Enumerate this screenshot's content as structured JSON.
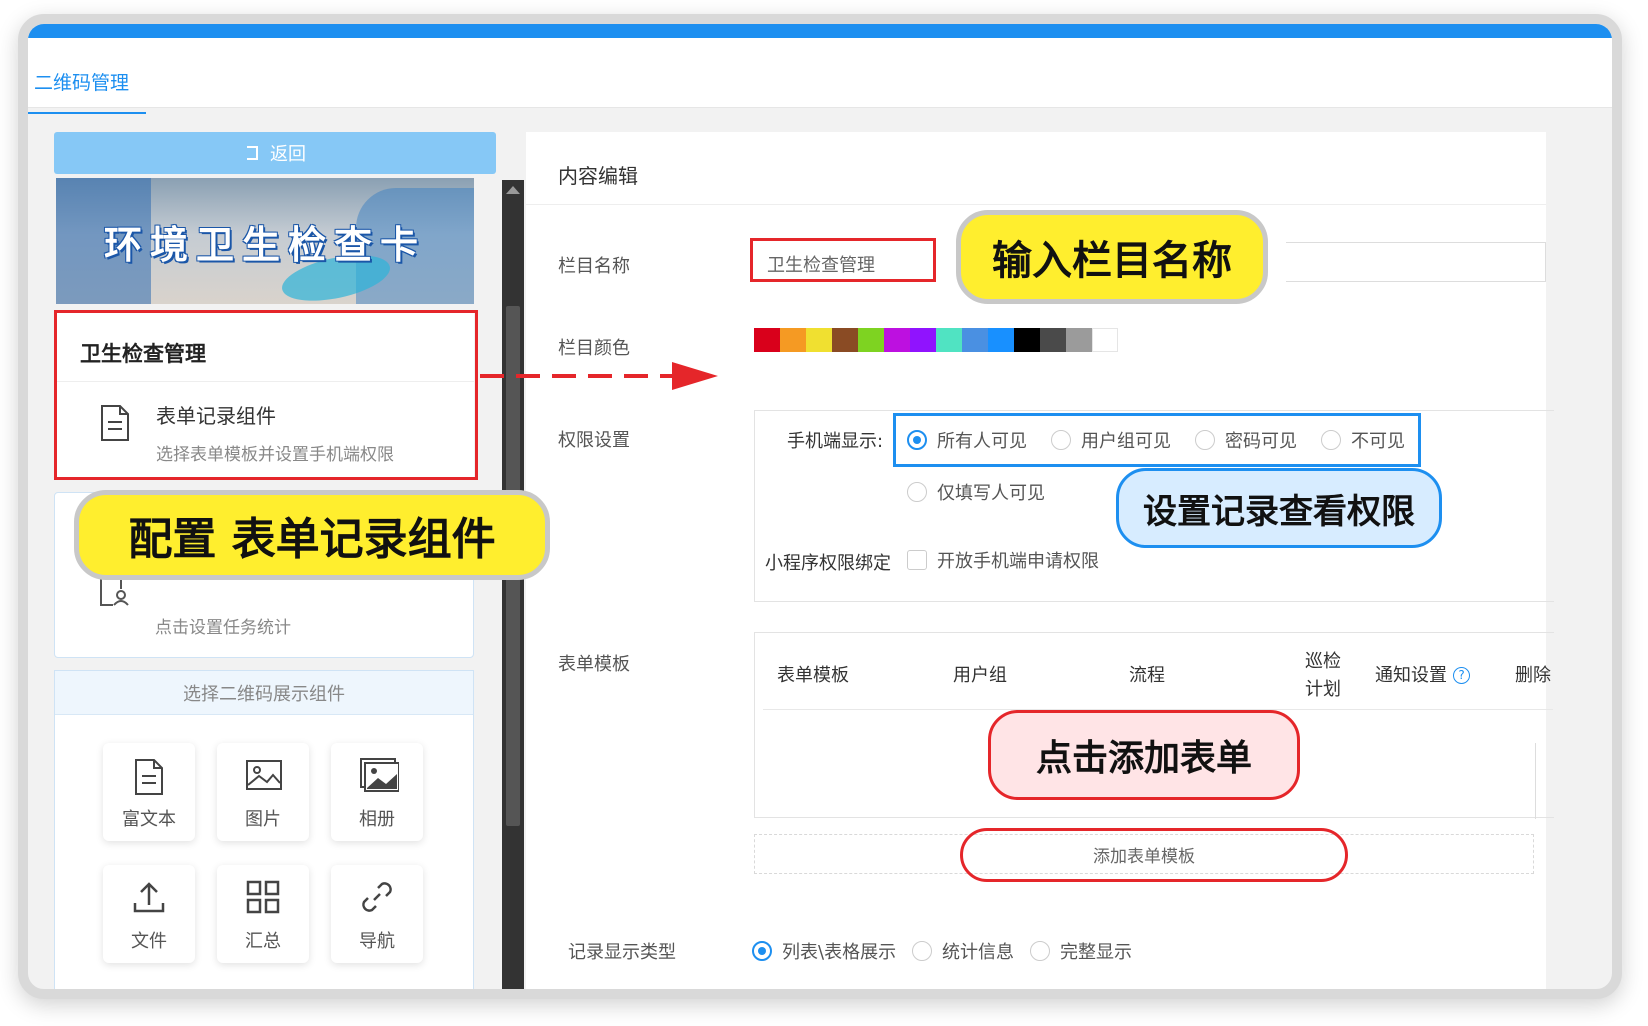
{
  "header": {
    "active_tab": "二维码管理"
  },
  "left": {
    "back_label": "返回",
    "banner_title": "环境卫生检查卡",
    "section1_title": "卫生检查管理",
    "component_name": "表单记录组件",
    "component_desc": "选择表单模板并设置手机端权限",
    "card2_desc": "点击设置任务统计",
    "select_header": "选择二维码展示组件",
    "tiles": [
      {
        "label": "富文本",
        "icon": "rich-text-icon"
      },
      {
        "label": "图片",
        "icon": "image-icon"
      },
      {
        "label": "相册",
        "icon": "album-icon"
      },
      {
        "label": "文件",
        "icon": "upload-icon"
      },
      {
        "label": "汇总",
        "icon": "grid-icon"
      },
      {
        "label": "导航",
        "icon": "link-icon"
      }
    ]
  },
  "right": {
    "title": "内容编辑",
    "name_label": "栏目名称",
    "name_value": "卫生检查管理",
    "color_label": "栏目颜色",
    "colors": [
      "#d9001b",
      "#f59a23",
      "#f0e030",
      "#8a4b24",
      "#7ed321",
      "#bd10e0",
      "#9013fe",
      "#50e3c2",
      "#4a90e2",
      "#1890ff",
      "#000000",
      "#4a4a4a",
      "#9b9b9b",
      "#ffffff"
    ],
    "perm_label": "权限设置",
    "mobile_label": "手机端显示:",
    "options": [
      "所有人可见",
      "用户组可见",
      "密码可见",
      "不可见",
      "仅填写人可见"
    ],
    "selected_option": "所有人可见",
    "mini_label": "小程序权限绑定",
    "mini_checkbox": "开放手机端申请权限",
    "template_label": "表单模板",
    "table_headers": [
      "表单模板",
      "用户组",
      "流程",
      "巡检",
      "计划",
      "通知设置",
      "删除"
    ],
    "add_template": "添加表单模板",
    "display_label": "记录显示类型",
    "display_options": [
      "列表\\表格展示",
      "统计信息",
      "完整显示"
    ]
  },
  "callouts": {
    "name": "输入栏目名称",
    "config": "配置 表单记录组件",
    "perm": "设置记录查看权限",
    "add": "点击添加表单"
  },
  "colors": {
    "accent": "#1d8ff0",
    "highlight_red": "#e5262a",
    "callout_yellow": "#ffee2e"
  }
}
